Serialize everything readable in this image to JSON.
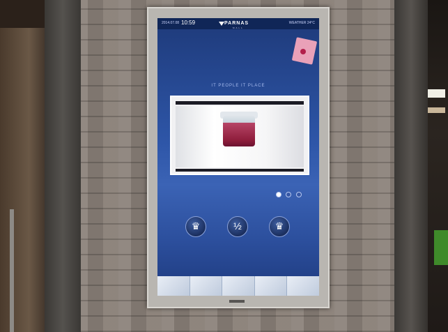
{
  "kiosk": {
    "date": "2014.07.08",
    "time": "10:59",
    "brand": "PARNAS",
    "brand_sub": "MALL",
    "top_right": "WEATHER  24°C",
    "intro_line1": "",
    "intro_line2": "",
    "tagline": "IT PEOPLE IT PLACE",
    "dots": [
      "",
      "",
      ""
    ],
    "circle_buttons": [
      {
        "label": "",
        "glyph": "♛"
      },
      {
        "label": "",
        "glyph": "½"
      },
      {
        "label": "",
        "glyph": "♛"
      }
    ],
    "bottom_tabs": [
      "",
      "",
      "",
      "",
      ""
    ]
  },
  "colors": {
    "screen_blue": "#2e56a8",
    "accent_pink": "#e9a1b8",
    "product_red": "#8e1d3b"
  }
}
